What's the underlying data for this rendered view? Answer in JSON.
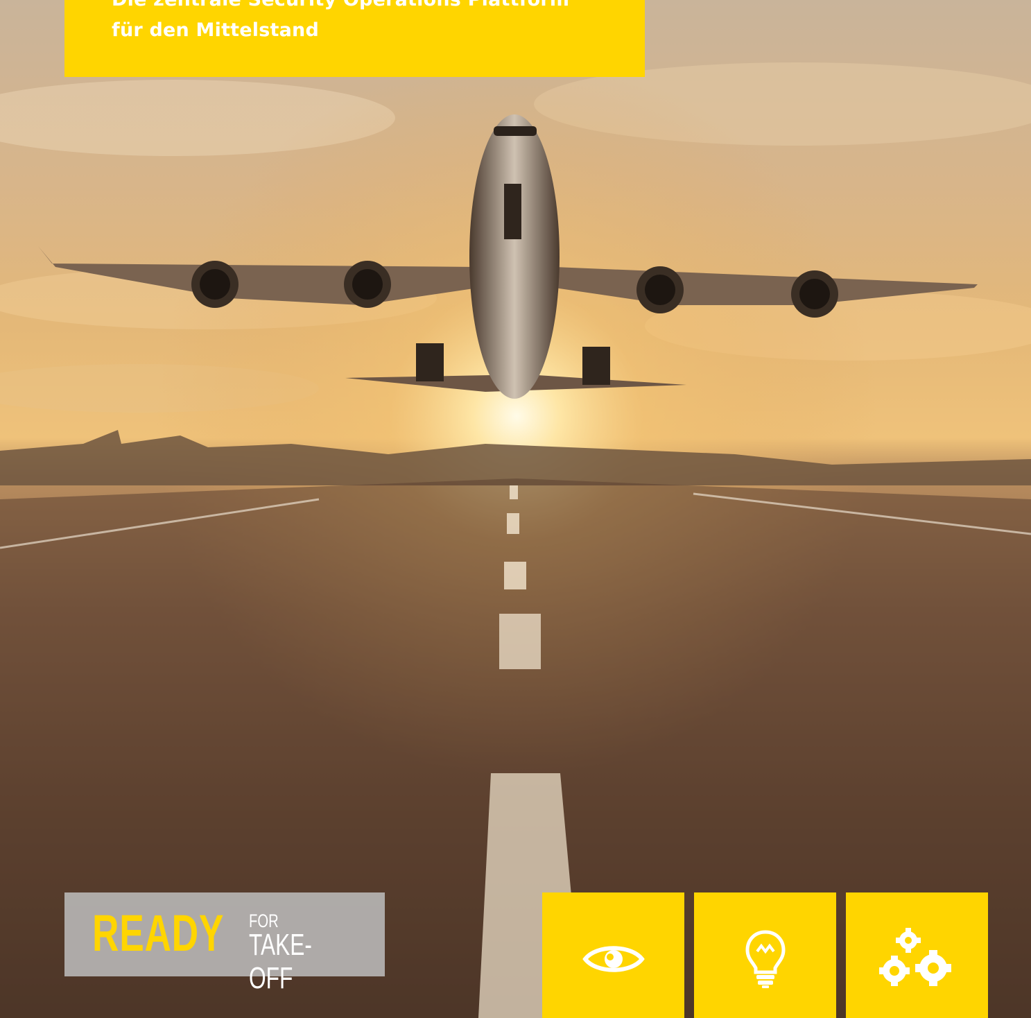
{
  "headline": {
    "line1": "Die zentrale Security Operations Plattform",
    "line2": "für den Mittelstand"
  },
  "tagline": {
    "ready": "READY",
    "for": "FOR",
    "takeoff": "TAKE-OFF"
  },
  "features": [
    {
      "icon": "eye-icon"
    },
    {
      "icon": "lightbulb-icon"
    },
    {
      "icon": "gears-icon"
    }
  ],
  "colors": {
    "accent": "#ffd500",
    "tagline_bg": "#bebebe"
  }
}
